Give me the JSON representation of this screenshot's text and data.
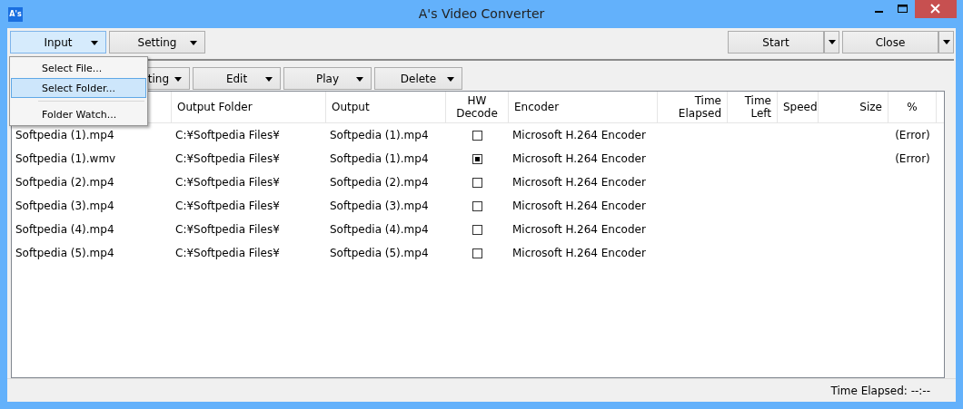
{
  "window": {
    "title": "A's Video Converter",
    "app_icon": "A's"
  },
  "toolbar": {
    "left": [
      {
        "label": "Input",
        "selected": true
      },
      {
        "label": "Setting",
        "selected": false
      }
    ],
    "right": [
      {
        "label": "Start"
      },
      {
        "label": "Close"
      }
    ]
  },
  "input_menu": {
    "items": [
      {
        "label": "Select File...",
        "selected": false
      },
      {
        "label": "Select Folder...",
        "selected": true
      },
      {
        "label": "Folder Watch...",
        "selected": false
      }
    ]
  },
  "list_toolbar": [
    {
      "label": "ting"
    },
    {
      "label": "Edit"
    },
    {
      "label": "Play"
    },
    {
      "label": "Delete"
    }
  ],
  "table": {
    "columns": [
      "Output Folder",
      "Output",
      "HW\nDecode",
      "Encoder",
      "Time\nElapsed",
      "Time\nLeft",
      "Speed",
      "Size",
      "%"
    ],
    "rows": [
      {
        "input": "Softpedia (1).mp4",
        "output_folder": "C:¥Softpedia Files¥",
        "output": "Softpedia (1).mp4",
        "hw_decode": false,
        "encoder": "Microsoft H.264 Encoder",
        "percent": "(Error)"
      },
      {
        "input": "Softpedia (1).wmv",
        "output_folder": "C:¥Softpedia Files¥",
        "output": "Softpedia (1).mp4",
        "hw_decode": true,
        "encoder": "Microsoft H.264 Encoder",
        "percent": "(Error)"
      },
      {
        "input": "Softpedia (2).mp4",
        "output_folder": "C:¥Softpedia Files¥",
        "output": "Softpedia (2).mp4",
        "hw_decode": false,
        "encoder": "Microsoft H.264 Encoder"
      },
      {
        "input": "Softpedia (3).mp4",
        "output_folder": "C:¥Softpedia Files¥",
        "output": "Softpedia (3).mp4",
        "hw_decode": false,
        "encoder": "Microsoft H.264 Encoder"
      },
      {
        "input": "Softpedia (4).mp4",
        "output_folder": "C:¥Softpedia Files¥",
        "output": "Softpedia (4).mp4",
        "hw_decode": false,
        "encoder": "Microsoft H.264 Encoder"
      },
      {
        "input": "Softpedia (5).mp4",
        "output_folder": "C:¥Softpedia Files¥",
        "output": "Softpedia (5).mp4",
        "hw_decode": false,
        "encoder": "Microsoft H.264 Encoder"
      }
    ]
  },
  "status_bar": {
    "text": "Time Elapsed: --:--"
  }
}
